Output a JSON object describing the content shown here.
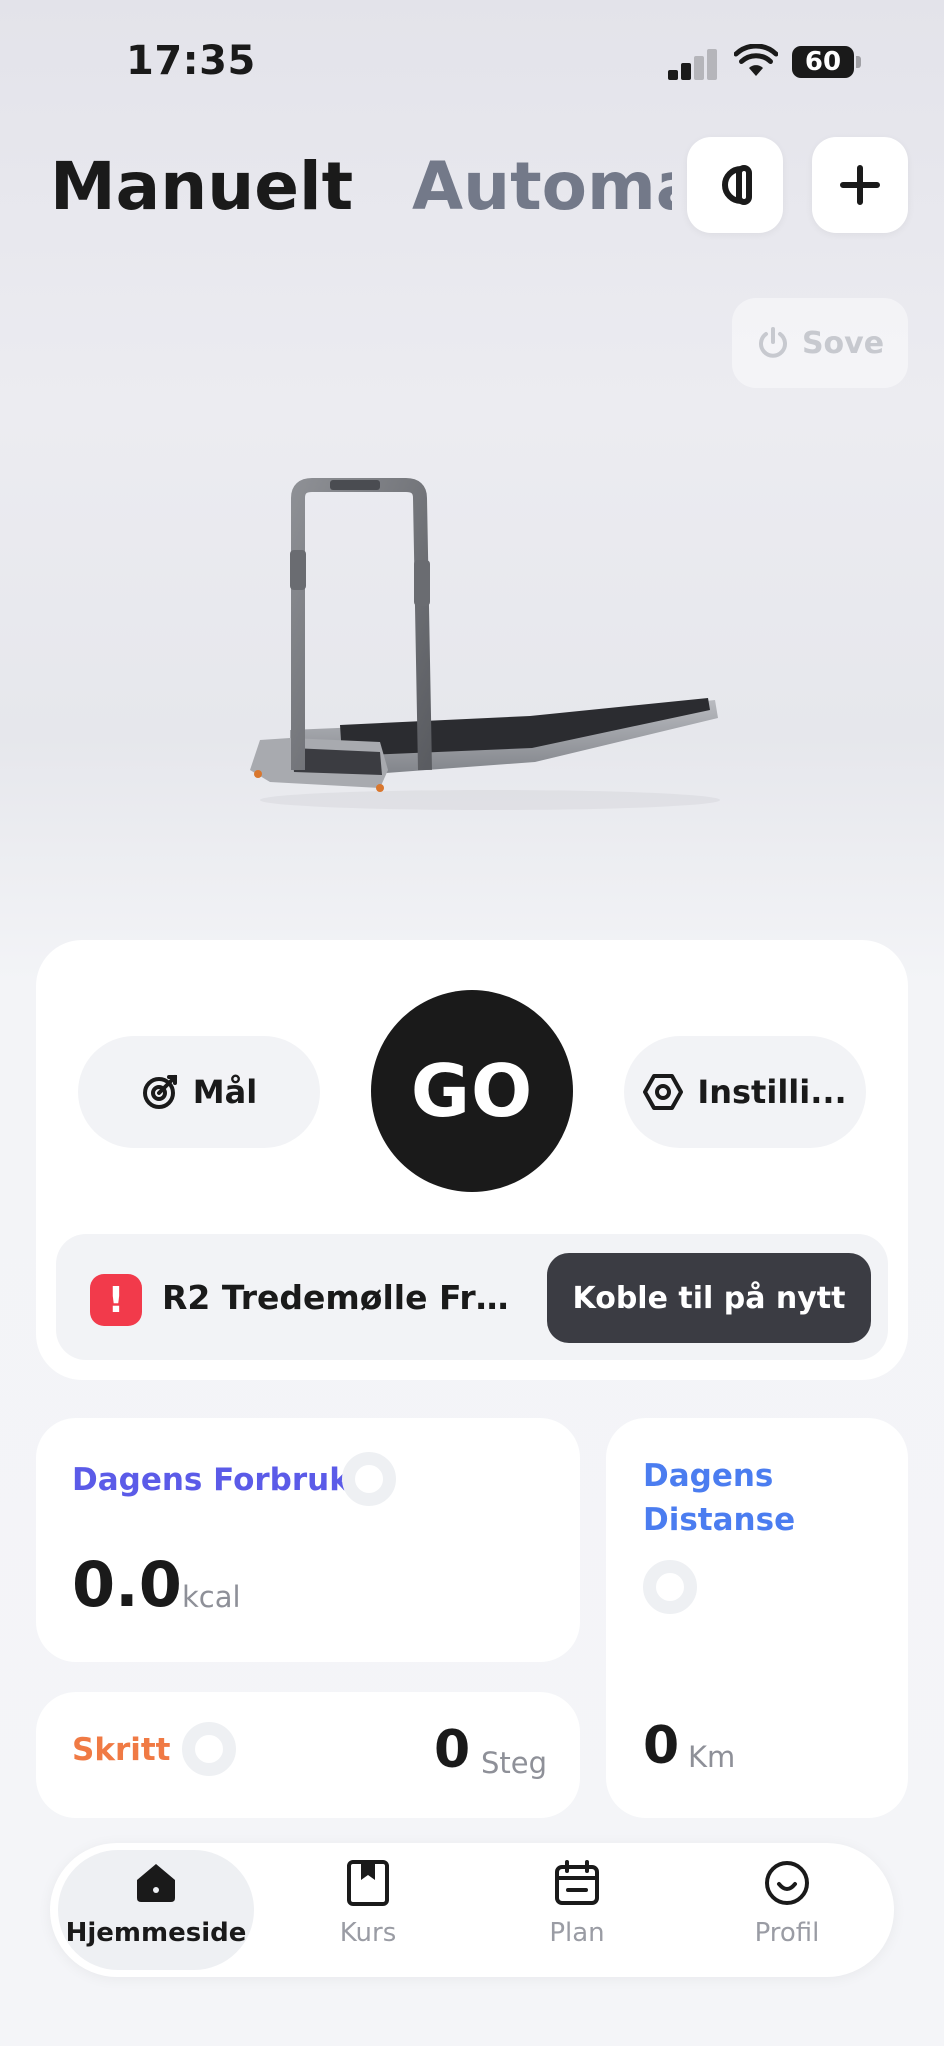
{
  "status_bar": {
    "time": "17:35",
    "battery": "60"
  },
  "header": {
    "tabs": [
      "Manuelt",
      "Automa"
    ],
    "active_tab": "Manuelt"
  },
  "sleep_button": {
    "label": "Sove"
  },
  "controls": {
    "goal_label": "Mål",
    "go_label": "GO",
    "settings_label": "Instilli..."
  },
  "notice": {
    "device_text": "R2 Tredemølle Fra...",
    "reconnect_label": "Koble til på nytt"
  },
  "stats": {
    "consumption": {
      "label": "Dagens Forbruk",
      "value": "0.0",
      "unit": "kcal"
    },
    "distance": {
      "label": "Dagens Distanse",
      "value": "0",
      "unit": "Km"
    },
    "steps": {
      "label": "Skritt",
      "value": "0",
      "unit": "Steg"
    }
  },
  "nav": {
    "items": [
      {
        "label": "Hjemmeside",
        "icon": "home-icon",
        "active": true
      },
      {
        "label": "Kurs",
        "icon": "bookmark-icon",
        "active": false
      },
      {
        "label": "Plan",
        "icon": "calendar-icon",
        "active": false
      },
      {
        "label": "Profil",
        "icon": "smile-icon",
        "active": false
      }
    ]
  },
  "colors": {
    "consumption": "#5b5be8",
    "distance": "#4b7df0",
    "steps": "#f07a44",
    "alert": "#f23a4b",
    "dark": "#1a1a1a"
  }
}
